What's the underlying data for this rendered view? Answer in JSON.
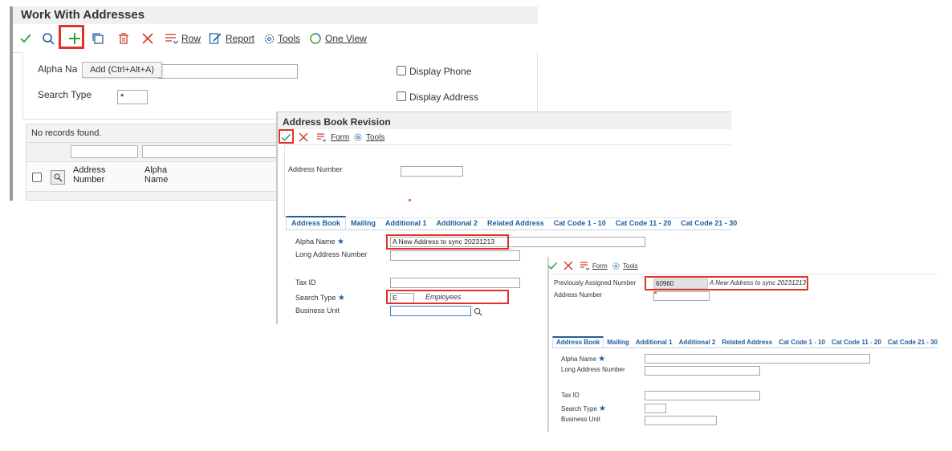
{
  "panel1": {
    "title": "Work With Addresses",
    "toolbar": {
      "row_label": "Row",
      "report_label": "Report",
      "tools_label": "Tools",
      "oneview_label": "One View"
    },
    "tooltip": "Add (Ctrl+Alt+A)",
    "filters": {
      "alpha_name_label": "Alpha Na",
      "alpha_name_value": "",
      "search_type_label": "Search Type",
      "search_type_value": "*",
      "display_phone_label": "Display Phone",
      "display_address_label": "Display Address"
    },
    "grid": {
      "status": "No records found.",
      "columns": [
        "Address Number",
        "Alpha Name"
      ]
    }
  },
  "panel2": {
    "title": "Address Book Revision",
    "toolbar": {
      "form_label": "Form",
      "tools_label": "Tools"
    },
    "address_number_label": "Address Number",
    "address_number_value": "",
    "tabs": [
      "Address Book",
      "Mailing",
      "Additional 1",
      "Additional 2",
      "Related Address",
      "Cat Code 1 - 10",
      "Cat Code 11 - 20",
      "Cat Code 21 - 30"
    ],
    "fields": {
      "alpha_name_label": "Alpha Name",
      "alpha_name_value": "A New Address to sync 20231213",
      "long_address_label": "Long Address Number",
      "tax_id_label": "Tax ID",
      "search_type_label": "Search Type",
      "search_type_value": "E",
      "search_type_desc": "Employees",
      "business_unit_label": "Business Unit"
    }
  },
  "panel3": {
    "toolbar": {
      "form_label": "Form",
      "tools_label": "Tools"
    },
    "prev_assigned_label": "Previously Assigned Number",
    "prev_assigned_value": "60960",
    "prev_assigned_desc": "A New Address to sync 20231213",
    "address_number_label": "Address Number",
    "tabs": [
      "Address Book",
      "Mailing",
      "Additional 1",
      "Additional 2",
      "Related Address",
      "Cat Code 1 - 10",
      "Cat Code 11 - 20",
      "Cat Code 21 - 30"
    ],
    "fields": {
      "alpha_name_label": "Alpha Name",
      "long_address_label": "Long Address Number",
      "tax_id_label": "Tax ID",
      "search_type_label": "Search Type",
      "business_unit_label": "Business Unit"
    }
  },
  "colors": {
    "accent_green": "#2e9e3e",
    "accent_red": "#d33a2c",
    "tab_blue": "#1f5fa0",
    "highlight_red": "#e0322b"
  }
}
